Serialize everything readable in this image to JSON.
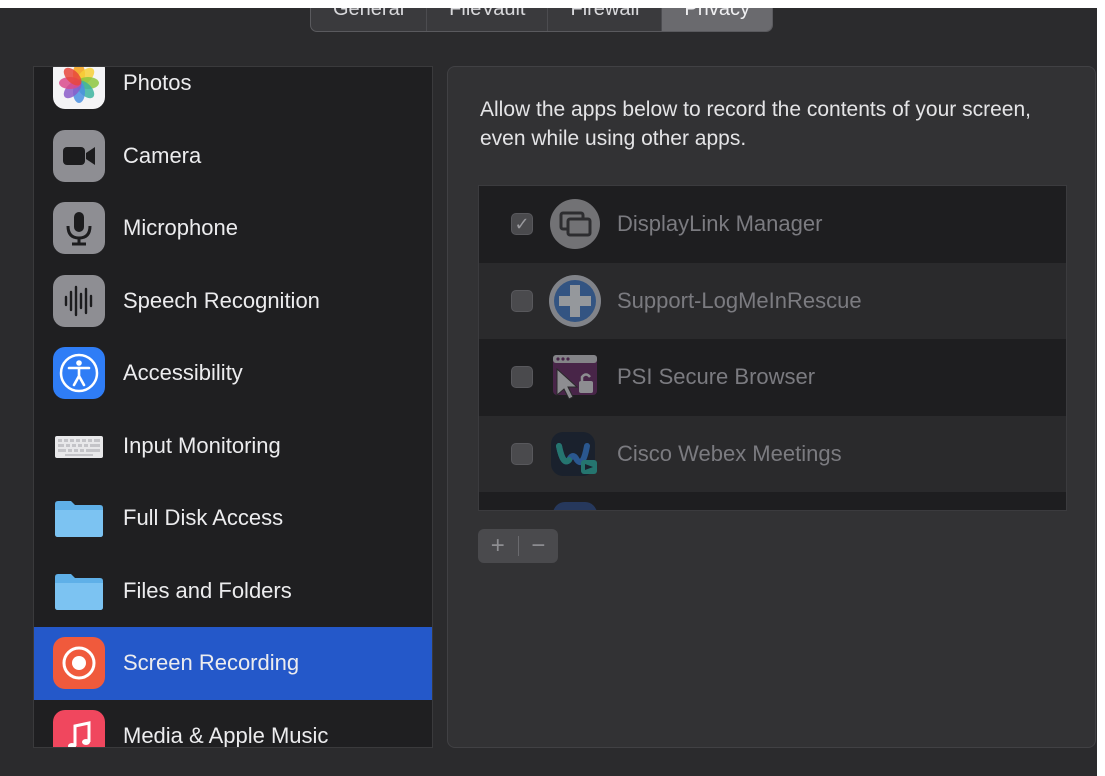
{
  "tabs": [
    {
      "label": "General"
    },
    {
      "label": "FileVault"
    },
    {
      "label": "Firewall"
    },
    {
      "label": "Privacy"
    }
  ],
  "sidebar": {
    "items": [
      {
        "label": "Photos",
        "icon": "photos-icon"
      },
      {
        "label": "Camera",
        "icon": "camera-icon"
      },
      {
        "label": "Microphone",
        "icon": "microphone-icon"
      },
      {
        "label": "Speech Recognition",
        "icon": "speech-waveform-icon"
      },
      {
        "label": "Accessibility",
        "icon": "accessibility-icon"
      },
      {
        "label": "Input Monitoring",
        "icon": "keyboard-icon"
      },
      {
        "label": "Full Disk Access",
        "icon": "folder-icon"
      },
      {
        "label": "Files and Folders",
        "icon": "folder-icon"
      },
      {
        "label": "Screen Recording",
        "icon": "screen-recording-icon"
      },
      {
        "label": "Media & Apple Music",
        "icon": "music-icon"
      }
    ]
  },
  "pane": {
    "description": "Allow the apps below to record the contents of your screen, even while using other apps.",
    "apps": [
      {
        "name": "DisplayLink Manager",
        "checked": true
      },
      {
        "name": "Support-LogMeInRescue",
        "checked": false
      },
      {
        "name": "PSI Secure Browser",
        "checked": false
      },
      {
        "name": "Cisco Webex Meetings",
        "checked": false
      }
    ],
    "add_label": "+",
    "remove_label": "−"
  },
  "colors": {
    "window_bg": "#2b2b2d",
    "selection": "#2458c9",
    "sidebar_bg": "#1f1f21"
  }
}
